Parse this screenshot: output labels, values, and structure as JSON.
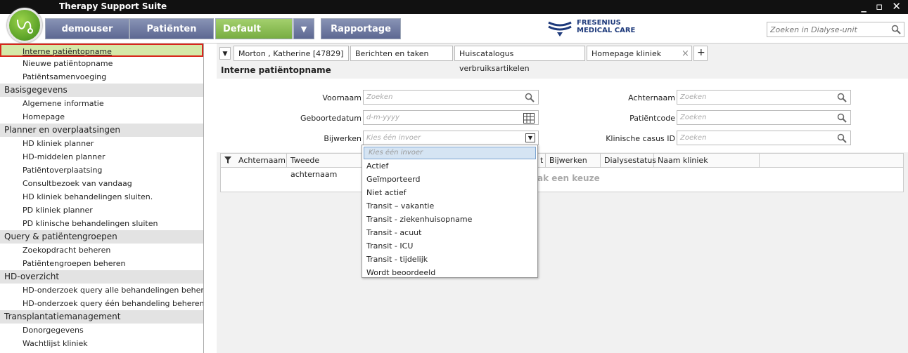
{
  "app": {
    "title": "Therapy Support Suite",
    "window_controls": "_ ▫ ✕"
  },
  "nav": {
    "user": "demouser",
    "patients": "Patiënten",
    "clinic": "Default Clinic",
    "clinic_dropdown": "▼",
    "reports": "Rapportage",
    "brand_line1": "FRESENIUS",
    "brand_line2": "MEDICAL CARE",
    "search_placeholder": "Zoeken in Dialyse-unit"
  },
  "sidebar": {
    "items": [
      {
        "type": "item",
        "label": "Interne patiëntopname",
        "active": true
      },
      {
        "type": "item",
        "label": "Nieuwe patiëntopname"
      },
      {
        "type": "item",
        "label": "Patiëntsamenvoeging"
      },
      {
        "type": "head",
        "label": "Basisgegevens"
      },
      {
        "type": "item",
        "label": "Algemene informatie"
      },
      {
        "type": "item",
        "label": "Homepage"
      },
      {
        "type": "head",
        "label": "Planner en overplaatsingen"
      },
      {
        "type": "item",
        "label": "HD kliniek planner"
      },
      {
        "type": "item",
        "label": "HD-middelen planner"
      },
      {
        "type": "item",
        "label": "Patiëntoverplaatsing"
      },
      {
        "type": "item",
        "label": "Consultbezoek van vandaag"
      },
      {
        "type": "item",
        "label": "HD kliniek behandelingen sluiten."
      },
      {
        "type": "item",
        "label": "PD kliniek planner"
      },
      {
        "type": "item",
        "label": "PD klinische behandelingen sluiten"
      },
      {
        "type": "head",
        "label": "Query & patiëntengroepen"
      },
      {
        "type": "item",
        "label": "Zoekopdracht beheren"
      },
      {
        "type": "item",
        "label": "Patiëntengroepen beheren"
      },
      {
        "type": "head",
        "label": "HD-overzicht"
      },
      {
        "type": "item",
        "label": "HD-onderzoek query alle behandelingen beher..."
      },
      {
        "type": "item",
        "label": "HD-onderzoek query één behandeling beheren"
      },
      {
        "type": "head",
        "label": "Transplantatiemanagement"
      },
      {
        "type": "item",
        "label": "Donorgegevens"
      },
      {
        "type": "item",
        "label": "Wachtlijst kliniek"
      }
    ]
  },
  "tabs": {
    "menu_icon": "▼",
    "patient": "Morton , Katherine [47829]",
    "messages": "Berichten en taken",
    "catalog": "Huiscatalogus verbruiksartikelen",
    "homepage": "Homepage kliniek",
    "close": "×",
    "add": "+"
  },
  "page": {
    "title": "Interne patiëntopname"
  },
  "form": {
    "first_name_label": "Voornaam",
    "first_name_placeholder": "Zoeken",
    "dob_label": "Geboortedatum",
    "dob_placeholder": "d-m-yyyy",
    "side_effects_label": "Bijwerken",
    "side_effects_placeholder": "Kies één invoer",
    "last_name_label": "Achternaam",
    "last_name_placeholder": "Zoeken",
    "patient_code_label": "Patiëntcode",
    "patient_code_placeholder": "Zoeken",
    "case_id_label": "Klinische casus ID",
    "case_id_placeholder": "Zoeken"
  },
  "grid": {
    "columns": [
      "Achternaam",
      "Tweede achternaam",
      "t",
      "Bijwerken",
      "Dialysestatus",
      "Naam kliniek"
    ],
    "message": "ak een keuze"
  },
  "dropdown": {
    "options": [
      "Kies één invoer",
      "Actief",
      "Geïmporteerd",
      "Niet actief",
      "Transit – vakantie",
      "Transit - ziekenhuisopname",
      "Transit - acuut",
      "Transit - ICU",
      "Transit - tijdelijk",
      "Wordt beoordeeld"
    ]
  }
}
